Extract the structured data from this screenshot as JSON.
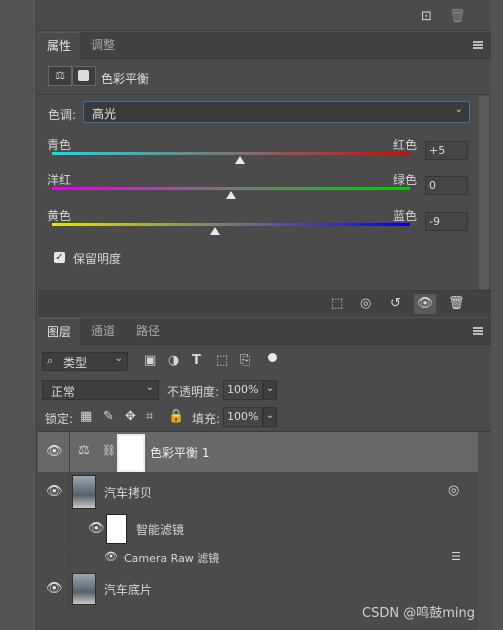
{
  "properties_tabs": [
    "属性",
    "调整"
  ],
  "properties": {
    "title": "色彩平衡",
    "tone_label": "色调:",
    "tone_value": "高光",
    "sliders": [
      {
        "left": "青色",
        "right": "红色",
        "value": "+5",
        "level": 0.525
      },
      {
        "left": "洋红",
        "right": "绿色",
        "value": "0",
        "level": 0.5
      },
      {
        "left": "黄色",
        "right": "蓝色",
        "value": "-9",
        "level": 0.455
      }
    ],
    "preserve_label": "保留明度",
    "preserve_checked": true
  },
  "layers_tabs": [
    "图层",
    "通道",
    "路径"
  ],
  "layers": {
    "filter_kind": "类型",
    "blend_mode": "正常",
    "opacity_label": "不透明度:",
    "opacity_value": "100%",
    "lock_label": "锁定:",
    "fill_label": "填充:",
    "fill_value": "100%",
    "items": [
      {
        "name": "色彩平衡 1",
        "type": "adjustment",
        "selected": true
      },
      {
        "name": "汽车拷贝",
        "type": "smart-object"
      },
      {
        "name": "智能滤镜",
        "type": "smart-filter"
      },
      {
        "name": "Camera Raw 滤镜",
        "type": "filter"
      },
      {
        "name": "汽车底片",
        "type": "image"
      }
    ]
  },
  "watermark": "CSDN @鸣鼓ming"
}
